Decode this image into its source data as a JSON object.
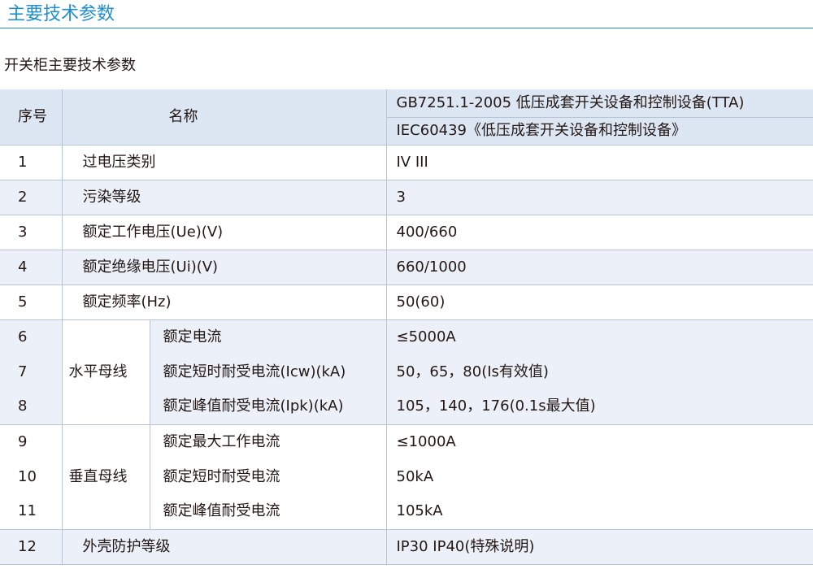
{
  "page": {
    "section_title": "主要技术参数",
    "subtitle": "开关柜主要技术参数"
  },
  "table": {
    "header": {
      "no": "序号",
      "name": "名称",
      "standard_1": "GB7251.1-2005 低压成套开关设备和控制设备(TTA)",
      "standard_2": "IEC60439《低压成套开关设备和控制设备》"
    },
    "rows": [
      {
        "no": "1",
        "name": "过电压类别",
        "value": "IV  III"
      },
      {
        "no": "2",
        "name": "污染等级",
        "value": " 3"
      },
      {
        "no": "3",
        "name": "额定工作电压(Ue)(V)",
        "value": "400/660"
      },
      {
        "no": "4",
        "name": "额定绝缘电压(Ui)(V)",
        "value": " 660/1000"
      },
      {
        "no": "5",
        "name": "额定频率(Hz)",
        "value": "50(60)"
      },
      {
        "no": "6",
        "group": "水平母线",
        "name": "额定电流",
        "value": "≤5000A"
      },
      {
        "no": "7",
        "name": "额定短时耐受电流(Icw)(kA)",
        "value": " 50，65，80(Is有效值)"
      },
      {
        "no": "8",
        "name": "额定峰值耐受电流(Ipk)(kA)",
        "value": "105，140，176(0.1s最大值)"
      },
      {
        "no": "9",
        "group": "垂直母线",
        "name": "额定最大工作电流",
        "value": "≤1000A"
      },
      {
        "no": "10",
        "name": "额定短时耐受电流",
        "value": "50kA"
      },
      {
        "no": "11",
        "name": "额定峰值耐受电流",
        "value": "105kA"
      },
      {
        "no": "12",
        "name": "外壳防护等级",
        "value": " IP30 IP40(特殊说明)"
      }
    ]
  }
}
